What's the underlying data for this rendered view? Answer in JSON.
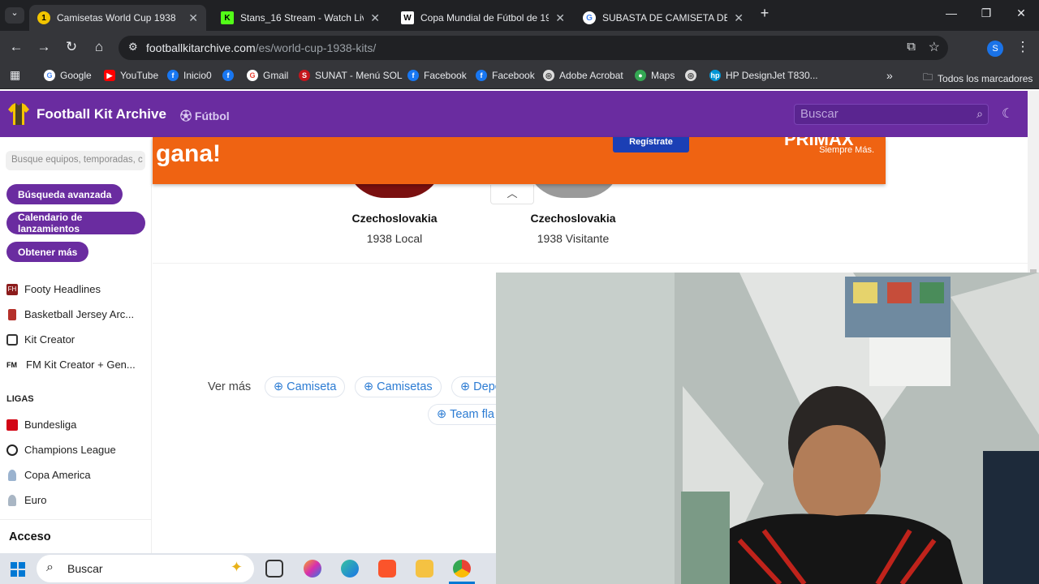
{
  "browser": {
    "tabs": [
      {
        "title": "Camisetas World Cup 1938",
        "active": true
      },
      {
        "title": "Stans_16 Stream - Watch Live o",
        "active": false
      },
      {
        "title": "Copa Mundial de Fútbol de 193",
        "active": false
      },
      {
        "title": "SUBASTA DE CAMISETA DE HU",
        "active": false
      }
    ],
    "url_host": "footballkitarchive.com",
    "url_path": "/es/world-cup-1938-kits/",
    "profile_initial": "S",
    "bookmarks": [
      "Google",
      "YouTube",
      "Inicio0",
      "Gmail",
      "SUNAT - Menú SOL",
      "Facebook",
      "Facebook",
      "Adobe Acrobat",
      "Maps",
      "HP DesignJet T830..."
    ],
    "all_bookmarks_label": "Todos los marcadores"
  },
  "site": {
    "name": "Football Kit Archive",
    "section": "Fútbol",
    "search_placeholder": "Buscar",
    "brand_color": "#6a2ca0"
  },
  "sidebar": {
    "search_placeholder": "Busque equipos, temporadas, c",
    "buttons": [
      "Búsqueda avanzada",
      "Calendario de lanzamientos",
      "Obtener más"
    ],
    "links": [
      "Footy Headlines",
      "Basketball Jersey Arc...",
      "Kit Creator",
      "FM Kit Creator + Gen..."
    ],
    "leagues_heading": "LIGAS",
    "leagues": [
      "Bundesliga",
      "Champions League",
      "Copa America",
      "Euro"
    ],
    "access_heading": "Acceso"
  },
  "ad": {
    "headline": "gana!",
    "button": "Regístrate",
    "brand": "PRIMAX",
    "slogan": "Siempre Más."
  },
  "kits": [
    {
      "team": "Czechoslovakia",
      "label": "1938 Local"
    },
    {
      "team": "Czechoslovakia",
      "label": "1938 Visitante"
    }
  ],
  "more": {
    "label": "Ver más",
    "tags": [
      "Camiseta",
      "Camisetas",
      "Depo",
      "Team fla"
    ]
  },
  "taskbar": {
    "search_label": "Buscar"
  }
}
